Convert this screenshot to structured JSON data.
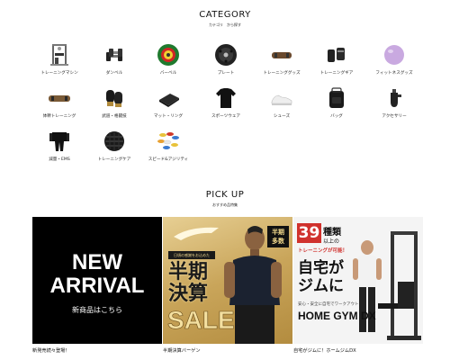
{
  "category": {
    "title": "CATEGORY",
    "subtitle": "カテゴリ　から探す",
    "items": [
      {
        "label": "トレーニングマシン",
        "icon": "training-machine-icon"
      },
      {
        "label": "ダンベル",
        "icon": "dumbbell-icon"
      },
      {
        "label": "バーベル",
        "icon": "barbell-plates-icon"
      },
      {
        "label": "プレート",
        "icon": "plate-icon"
      },
      {
        "label": "トレーニンググッズ",
        "icon": "training-goods-icon"
      },
      {
        "label": "トレーニングギア",
        "icon": "training-gear-icon"
      },
      {
        "label": "フィットネスグッズ",
        "icon": "fitness-ball-icon"
      },
      {
        "label": "体幹トレーニング",
        "icon": "core-training-icon"
      },
      {
        "label": "武道・格闘技",
        "icon": "boxing-glove-icon"
      },
      {
        "label": "マット・リング",
        "icon": "mat-icon"
      },
      {
        "label": "スポーツウェア",
        "icon": "sportswear-icon"
      },
      {
        "label": "シューズ",
        "icon": "shoes-icon"
      },
      {
        "label": "バッグ",
        "icon": "bag-icon"
      },
      {
        "label": "アクセサリー",
        "icon": "accessory-icon"
      },
      {
        "label": "減量・EMS",
        "icon": "ems-suit-icon"
      },
      {
        "label": "トレーニングケア",
        "icon": "foam-roller-icon"
      },
      {
        "label": "スピード&アジリティ",
        "icon": "agility-cones-icon"
      }
    ]
  },
  "pickup": {
    "title": "PICK UP",
    "subtitle": "おすすめ品特集",
    "cards": [
      {
        "caption": "新発売続々登場！",
        "line1": "NEW",
        "line2": "ARRIVAL",
        "sub": "新商品はこちら",
        "bg": "#000000"
      },
      {
        "caption": "半期決算バーゲン",
        "badge_line1": "半期",
        "badge_line2": "多数",
        "tagline": "日頃の感謝をお込めた",
        "big1": "半期",
        "big2": "決算",
        "big3": "SALE",
        "bg": "#c9a55a"
      },
      {
        "caption": "自宅がジムに！ホームジムDX",
        "num": "39",
        "kind": "種類",
        "line2": "以上の",
        "line3": "トレーニングが可能！",
        "big1": "自宅が",
        "big2": "ジムに",
        "small": "安心・安全に自宅でワークアウト",
        "product": "HOME GYM DX",
        "accent": "#d0312d"
      }
    ]
  }
}
